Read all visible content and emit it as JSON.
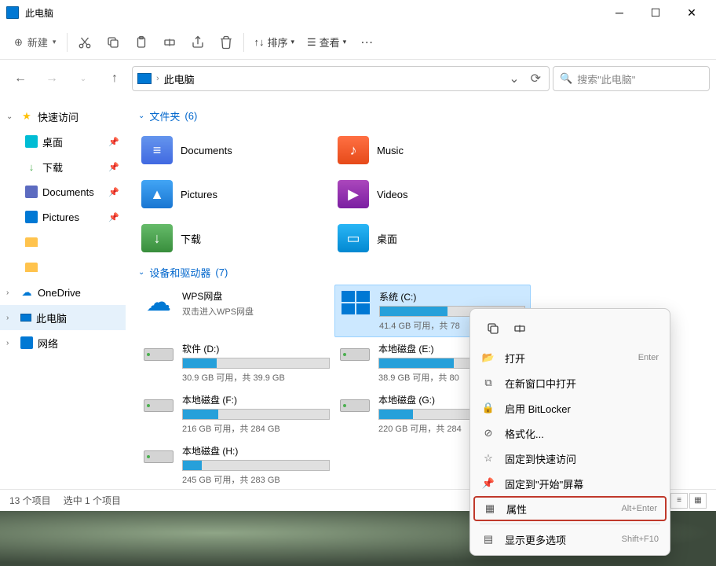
{
  "titlebar": {
    "title": "此电脑"
  },
  "toolbar": {
    "new": "新建",
    "sort": "排序",
    "view": "查看"
  },
  "addressbar": {
    "path": "此电脑"
  },
  "search": {
    "placeholder": "搜索\"此电脑\""
  },
  "sidebar": {
    "quick": "快速访问",
    "desktop": "桌面",
    "downloads": "下载",
    "documents": "Documents",
    "pictures": "Pictures",
    "onedrive": "OneDrive",
    "thispc": "此电脑",
    "network": "网络"
  },
  "sections": {
    "folders": {
      "label": "文件夹",
      "count": "(6)"
    },
    "drives": {
      "label": "设备和驱动器",
      "count": "(7)"
    }
  },
  "folders": [
    {
      "name": "Documents",
      "cls": "fi-doc"
    },
    {
      "name": "Music",
      "cls": "fi-music"
    },
    {
      "name": "Pictures",
      "cls": "fi-pic"
    },
    {
      "name": "Videos",
      "cls": "fi-video"
    },
    {
      "name": "下载",
      "cls": "fi-down"
    },
    {
      "name": "桌面",
      "cls": "fi-desk"
    }
  ],
  "drives": {
    "wps": {
      "name": "WPS网盘",
      "sub": "双击进入WPS网盘"
    },
    "c": {
      "name": "系统 (C:)",
      "sub": "41.4 GB 可用，共 78",
      "fill": 47
    },
    "d": {
      "name": "软件 (D:)",
      "sub": "30.9 GB 可用，共 39.9 GB",
      "fill": 23
    },
    "e": {
      "name": "本地磁盘 (E:)",
      "sub": "38.9 GB 可用，共 80",
      "fill": 51
    },
    "f": {
      "name": "本地磁盘 (F:)",
      "sub": "216 GB 可用，共 284 GB",
      "fill": 24
    },
    "g": {
      "name": "本地磁盘 (G:)",
      "sub": "220 GB 可用，共 284",
      "fill": 23
    },
    "h": {
      "name": "本地磁盘 (H:)",
      "sub": "245 GB 可用，共 283 GB",
      "fill": 13
    }
  },
  "statusbar": {
    "items": "13 个项目",
    "selected": "选中 1 个项目"
  },
  "context": {
    "open": {
      "label": "打开",
      "shortcut": "Enter"
    },
    "newwin": {
      "label": "在新窗口中打开"
    },
    "bitlocker": {
      "label": "启用 BitLocker"
    },
    "format": {
      "label": "格式化..."
    },
    "pinquick": {
      "label": "固定到快速访问"
    },
    "pinstart": {
      "label": "固定到\"开始\"屏幕"
    },
    "properties": {
      "label": "属性",
      "shortcut": "Alt+Enter"
    },
    "more": {
      "label": "显示更多选项",
      "shortcut": "Shift+F10"
    }
  }
}
